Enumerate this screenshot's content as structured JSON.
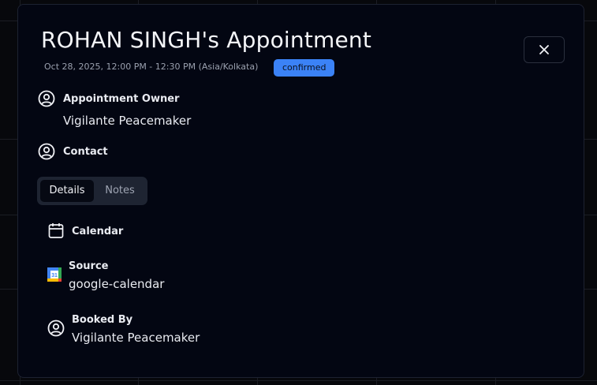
{
  "appointment": {
    "title": "ROHAN SINGH's Appointment",
    "datetime": "Oct 28, 2025, 12:00 PM - 12:30 PM (Asia/Kolkata)",
    "status": "confirmed"
  },
  "owner": {
    "label": "Appointment Owner",
    "value": "Vigilante Peacemaker"
  },
  "contact": {
    "label": "Contact"
  },
  "tabs": [
    {
      "label": "Details",
      "active": true
    },
    {
      "label": "Notes",
      "active": false
    }
  ],
  "details": {
    "calendar": {
      "label": "Calendar"
    },
    "source": {
      "label": "Source",
      "value": "google-calendar",
      "badge": "31"
    },
    "booked_by": {
      "label": "Booked By",
      "value": "Vigilante Peacemaker"
    }
  },
  "colors": {
    "accent": "#3b82f6",
    "modal_bg": "#030612",
    "tabs_bg": "#1e2432"
  }
}
